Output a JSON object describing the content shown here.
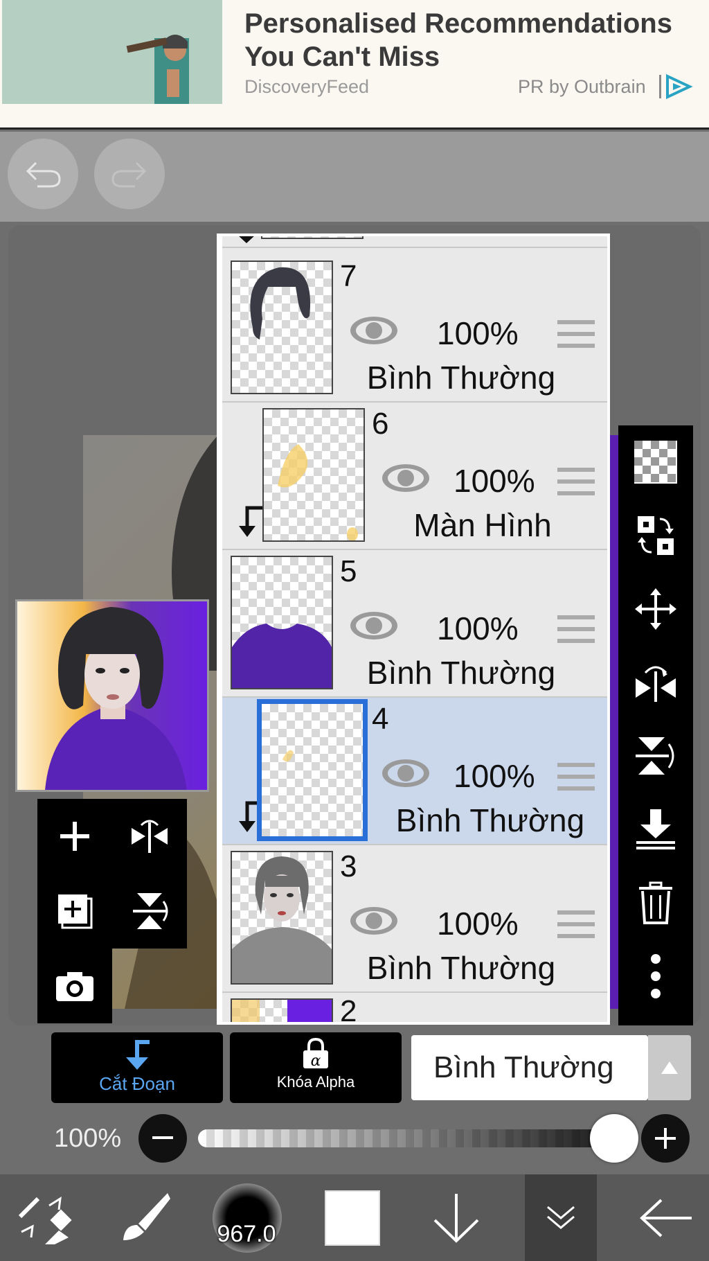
{
  "ad": {
    "title": "Personalised Recommendations You Can't Miss",
    "source": "DiscoveryFeed",
    "pr": "PR by Outbrain"
  },
  "layers": [
    {
      "number": "7",
      "opacity": "100%",
      "blend": "Bình Thường",
      "clipped": false,
      "selected": false
    },
    {
      "number": "6",
      "opacity": "100%",
      "blend": "Màn Hình",
      "clipped": true,
      "selected": false
    },
    {
      "number": "5",
      "opacity": "100%",
      "blend": "Bình Thường",
      "clipped": false,
      "selected": false
    },
    {
      "number": "4",
      "opacity": "100%",
      "blend": "Bình Thường",
      "clipped": true,
      "selected": true
    },
    {
      "number": "3",
      "opacity": "100%",
      "blend": "Bình Thường",
      "clipped": false,
      "selected": false
    },
    {
      "number": "2"
    }
  ],
  "controls": {
    "clip_label": "Cắt Đoạn",
    "alpha_label": "Khóa Alpha",
    "blend_mode": "Bình Thường",
    "opacity_label": "100%",
    "opacity_value": 1.0
  },
  "bottom_nav": {
    "brush_size": "967.0"
  },
  "colors": {
    "accent": "#2a6fd8",
    "clip_label": "#5aa6f0",
    "selected_row": "#cbd8ec",
    "purple": "#5a1fb0"
  }
}
